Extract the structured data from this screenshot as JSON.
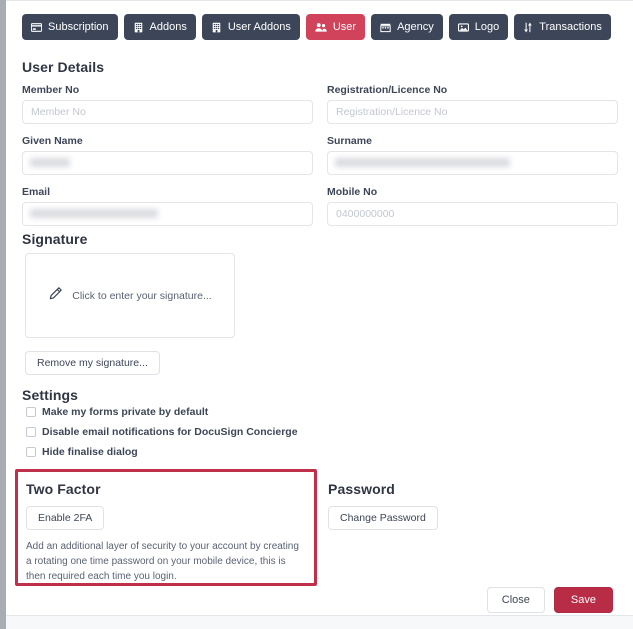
{
  "tabs": [
    {
      "label": "Subscription",
      "icon": "credit-card-icon",
      "active": false
    },
    {
      "label": "Addons",
      "icon": "building-icon",
      "active": false
    },
    {
      "label": "User Addons",
      "icon": "building-icon",
      "active": false
    },
    {
      "label": "User",
      "icon": "users-icon",
      "active": true
    },
    {
      "label": "Agency",
      "icon": "store-icon",
      "active": false
    },
    {
      "label": "Logo",
      "icon": "image-icon",
      "active": false
    },
    {
      "label": "Transactions",
      "icon": "sort-arrows-icon",
      "active": false
    }
  ],
  "user_details": {
    "heading": "User Details",
    "member_no": {
      "label": "Member No",
      "placeholder": "Member No",
      "value": ""
    },
    "registration_no": {
      "label": "Registration/Licence No",
      "placeholder": "Registration/Licence No",
      "value": ""
    },
    "given_name": {
      "label": "Given Name",
      "placeholder": "",
      "value": "",
      "redacted": true,
      "redacted_width": 40
    },
    "surname": {
      "label": "Surname",
      "placeholder": "",
      "value": "",
      "redacted": true,
      "redacted_width": 175
    },
    "email": {
      "label": "Email",
      "placeholder": "",
      "value": "",
      "redacted": true,
      "redacted_width": 128
    },
    "mobile_no": {
      "label": "Mobile No",
      "placeholder": "0400000000",
      "value": ""
    }
  },
  "signature": {
    "heading": "Signature",
    "placeholder_text": "Click to enter your signature...",
    "remove_button": "Remove my signature..."
  },
  "settings": {
    "heading": "Settings",
    "options": [
      {
        "label": "Make my forms private by default",
        "checked": false
      },
      {
        "label": "Disable email notifications for DocuSign Concierge",
        "checked": false
      },
      {
        "label": "Hide finalise dialog",
        "checked": false
      }
    ]
  },
  "two_factor": {
    "heading": "Two Factor",
    "button": "Enable 2FA",
    "description": "Add an additional layer of security to your account by creating a rotating one time password on your mobile device, this is then required each time you login."
  },
  "password": {
    "heading": "Password",
    "button": "Change Password"
  },
  "footer": {
    "close": "Close",
    "save": "Save"
  },
  "colors": {
    "tab_inactive": "#3c4658",
    "tab_active": "#d1435b",
    "save_button": "#b92c46",
    "highlight_border": "#c0304a",
    "text_primary": "#2f3542",
    "text_secondary": "#5a6273",
    "field_border": "#e2e5ea"
  }
}
